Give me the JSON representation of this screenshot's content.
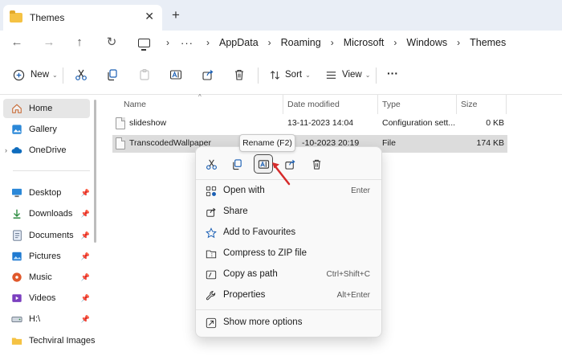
{
  "tab": {
    "title": "Themes",
    "close_glyph": "✕",
    "new_tab_glyph": "+"
  },
  "address": {
    "more": "···",
    "crumbs": [
      "AppData",
      "Roaming",
      "Microsoft",
      "Windows",
      "Themes"
    ]
  },
  "toolbar": {
    "new_label": "New",
    "sort_label": "Sort",
    "view_label": "View",
    "more_glyph": "···"
  },
  "sidebar": {
    "items": [
      {
        "label": "Home",
        "icon": "home-icon"
      },
      {
        "label": "Gallery",
        "icon": "gallery-icon"
      },
      {
        "label": "OneDrive",
        "icon": "onedrive-icon"
      },
      {
        "label": "Desktop",
        "icon": "desktop-icon"
      },
      {
        "label": "Downloads",
        "icon": "downloads-icon"
      },
      {
        "label": "Documents",
        "icon": "documents-icon"
      },
      {
        "label": "Pictures",
        "icon": "pictures-icon"
      },
      {
        "label": "Music",
        "icon": "music-icon"
      },
      {
        "label": "Videos",
        "icon": "videos-icon"
      },
      {
        "label": "H:\\",
        "icon": "drive-icon"
      },
      {
        "label": "Techviral Images",
        "icon": "folder-icon"
      }
    ]
  },
  "columns": {
    "name": "Name",
    "date": "Date modified",
    "type": "Type",
    "size": "Size"
  },
  "files": [
    {
      "name": "slideshow",
      "date": "13-11-2023 14:04",
      "type": "Configuration sett...",
      "size": "0 KB"
    },
    {
      "name": "TranscodedWallpaper",
      "date": "-10-2023 20:19",
      "type": "File",
      "size": "174 KB"
    }
  ],
  "tooltip": "Rename (F2)",
  "context_menu": {
    "items": [
      {
        "label": "Open with",
        "key": "Enter",
        "icon": "open-with-icon"
      },
      {
        "label": "Share",
        "key": "",
        "icon": "share-icon"
      },
      {
        "label": "Add to Favourites",
        "key": "",
        "icon": "star-icon"
      },
      {
        "label": "Compress to ZIP file",
        "key": "",
        "icon": "zip-icon"
      },
      {
        "label": "Copy as path",
        "key": "Ctrl+Shift+C",
        "icon": "copy-path-icon"
      },
      {
        "label": "Properties",
        "key": "Alt+Enter",
        "icon": "properties-icon"
      }
    ],
    "more": {
      "label": "Show more options",
      "icon": "more-options-icon"
    }
  },
  "colors": {
    "accent_arrow": "#d62b2b",
    "selection": "#dcdcdc",
    "tabbar": "#e9eef6"
  }
}
